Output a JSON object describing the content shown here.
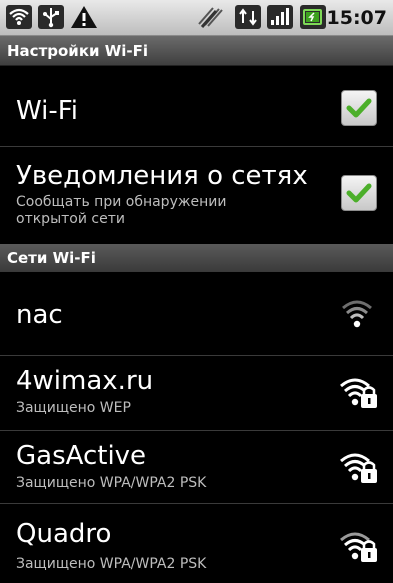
{
  "status_bar": {
    "time": "15:07",
    "icons": [
      "wifi-bars-icon",
      "usb-icon",
      "warning-icon",
      "vibrate-icon",
      "data-transfer-icon",
      "signal-icon",
      "battery-icon"
    ]
  },
  "title_bar": {
    "title": "Настройки Wi-Fi"
  },
  "settings": [
    {
      "title": "Wi-Fi",
      "checked": true
    },
    {
      "title": "Уведомления о сетях",
      "summary": "Сообщать при обнаружении открытой сети",
      "summary_lines": [
        "Сообщать при обнаружении",
        "открытой сети"
      ],
      "checked": true
    }
  ],
  "networks_header": "Сети Wi-Fi",
  "networks": [
    {
      "ssid": "nac",
      "security": "",
      "secured": false,
      "icon": "wifi-open-icon"
    },
    {
      "ssid": "4wimax.ru",
      "security": "Защищено WEP",
      "secured": true,
      "icon": "wifi-locked-icon"
    },
    {
      "ssid": "GasActive",
      "security": "Защищено WPA/WPA2 PSK",
      "secured": true,
      "icon": "wifi-locked-icon"
    },
    {
      "ssid": "Quadro",
      "security": "Защищено WPA/WPA2 PSK",
      "secured": true,
      "icon": "wifi-locked-icon"
    }
  ],
  "colors": {
    "check": "#4caf2a",
    "background": "#000000",
    "header": "#4a4a4a"
  }
}
